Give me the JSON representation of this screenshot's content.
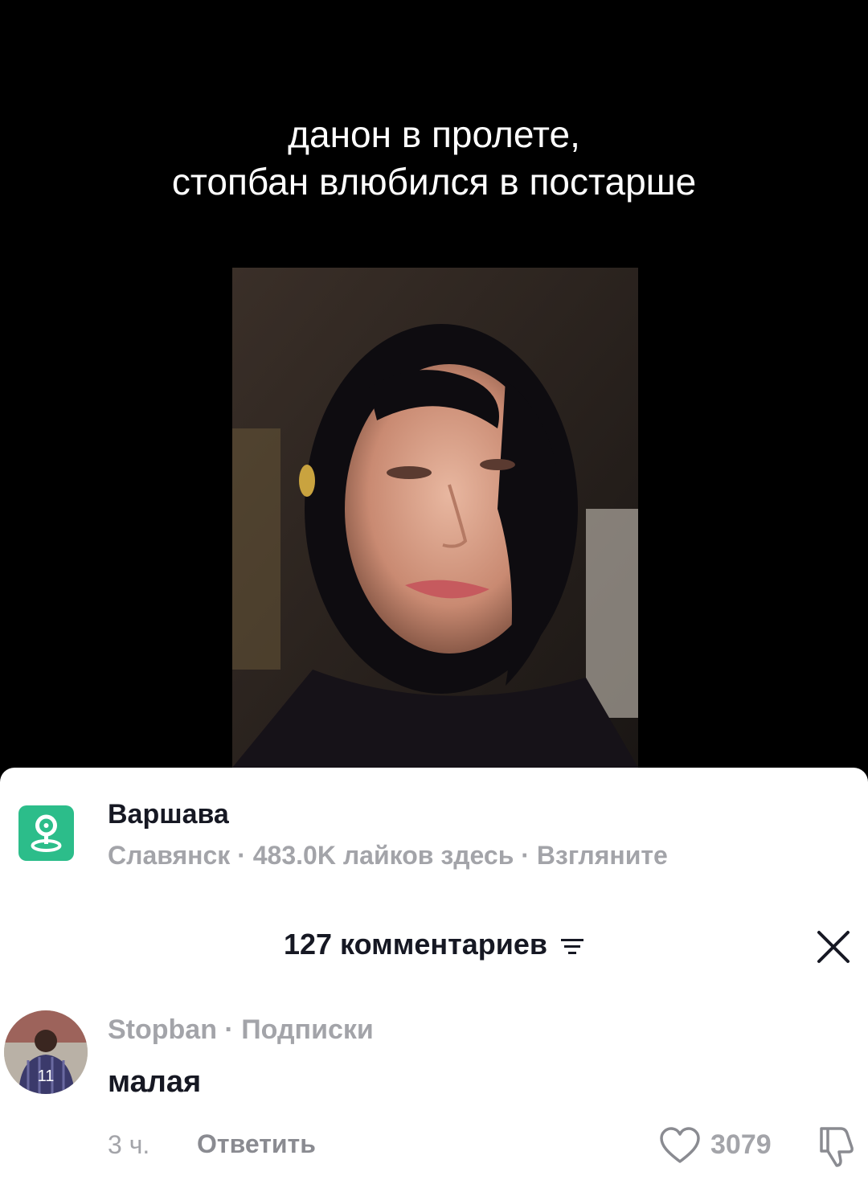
{
  "caption": {
    "line1": "данон в пролете,",
    "line2": "стопбан влюбился в постарше"
  },
  "location": {
    "icon": "location-pin-icon",
    "title": "Варшава",
    "subtitle": "Славянск · 483.0K лайков здесь · Взгляните"
  },
  "comments": {
    "header": "127 комментариев",
    "filter_icon": "filter-icon",
    "close_icon": "close-icon",
    "items": [
      {
        "author": "Stopban · Подписки",
        "text": "малая",
        "time": "3 ч.",
        "reply_label": "Ответить",
        "likes": "3079"
      }
    ]
  },
  "colors": {
    "background": "#000000",
    "sheet": "#ffffff",
    "accent_location": "#2cbd8a",
    "text_primary": "#161823",
    "text_secondary": "#a3a4a9"
  }
}
